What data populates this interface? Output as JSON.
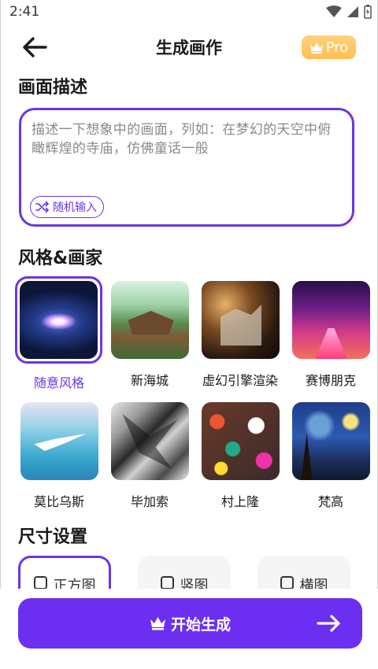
{
  "status_bar": {
    "time": "2:41"
  },
  "header": {
    "title": "生成画作",
    "pro_label": "Pro"
  },
  "description": {
    "heading": "画面描述",
    "placeholder": "描述一下想象中的画面，列如：在梦幻的天空中俯 瞰辉煌的寺庙，仿佛童话一般",
    "random_label": "随机输入"
  },
  "styles": {
    "heading": "风格&画家",
    "items": [
      {
        "label": "随意风格",
        "selected": true
      },
      {
        "label": "新海城"
      },
      {
        "label": "虚幻引擎渲染"
      },
      {
        "label": "赛博朋克"
      },
      {
        "label": "莫比乌斯"
      },
      {
        "label": "毕加索"
      },
      {
        "label": "村上隆"
      },
      {
        "label": "梵高"
      }
    ]
  },
  "size": {
    "heading": "尺寸设置",
    "options": [
      {
        "label": "正方图",
        "selected": true
      },
      {
        "label": "竖图"
      },
      {
        "label": "横图"
      }
    ]
  },
  "start_label": "开始生成",
  "colors": {
    "accent": "#6c35e6",
    "button": "#6c2ff2",
    "pro": "#ffc25c"
  }
}
